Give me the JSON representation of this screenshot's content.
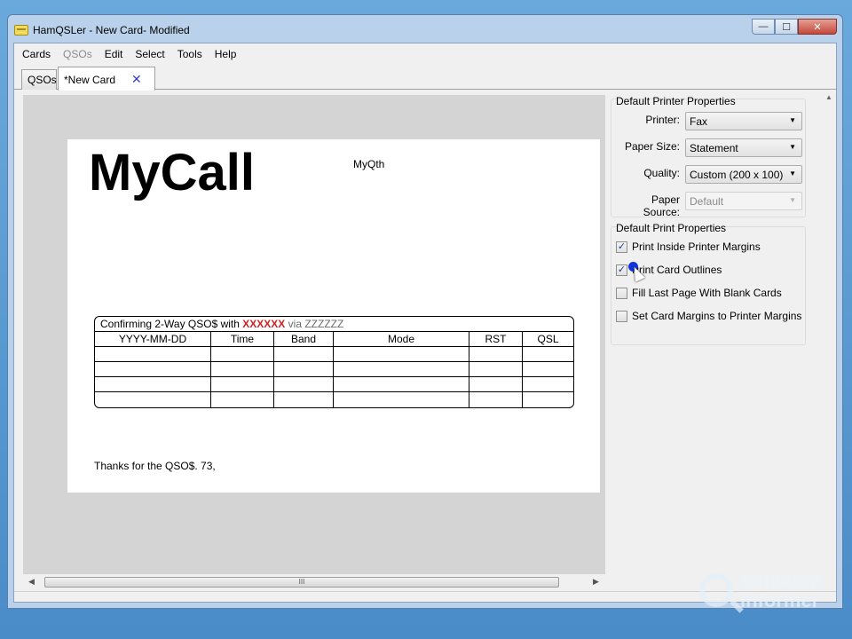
{
  "window": {
    "title": "HamQSLer - New Card- Modified",
    "controls": {
      "minimize": "—",
      "maximize": "☐",
      "close": "✕"
    }
  },
  "menu": {
    "items": [
      "Cards",
      "QSOs",
      "Edit",
      "Select",
      "Tools",
      "Help"
    ],
    "disabled": [
      "QSOs"
    ]
  },
  "tabs": {
    "items": [
      "QSOs",
      "*New Card"
    ],
    "active": "*New Card",
    "close_icon": "✕"
  },
  "card": {
    "call": "MyCall",
    "qth": "MyQth",
    "table_caption_prefix": "Confirming 2-Way QSO$ with",
    "table_caption_call": "XXXXXX",
    "table_caption_via": "via ZZZZZZ",
    "columns": [
      "YYYY-MM-DD",
      "Time",
      "Band",
      "Mode",
      "RST",
      "QSL"
    ],
    "empty_rows": 4,
    "thanks": "Thanks for the QSO$. 73,"
  },
  "scrollbar": {
    "left_arrow": "◀",
    "right_arrow": "▶",
    "grip": "III"
  },
  "printer_properties": {
    "title": "Default Printer Properties",
    "printer_label": "Printer:",
    "printer_value": "Fax",
    "paper_size_label": "Paper Size:",
    "paper_size_value": "Statement",
    "quality_label": "Quality:",
    "quality_value": "Custom (200 x 100)",
    "paper_source_label": "Paper Source:",
    "paper_source_value": "Default"
  },
  "print_properties": {
    "title": "Default Print Properties",
    "options": [
      {
        "label": "Print Inside Printer Margins",
        "checked": true
      },
      {
        "label": "Print Card Outlines",
        "checked": true
      },
      {
        "label": "Fill Last Page With Blank Cards",
        "checked": false
      },
      {
        "label": "Set Card Margins to Printer Margins",
        "checked": false
      }
    ]
  },
  "watermark": {
    "line1": "software",
    "line2": "informer"
  },
  "icons": {
    "app": "hamqsler-card-icon",
    "combo_caret": "▼",
    "check": "✓",
    "scroll_up": "▲"
  }
}
